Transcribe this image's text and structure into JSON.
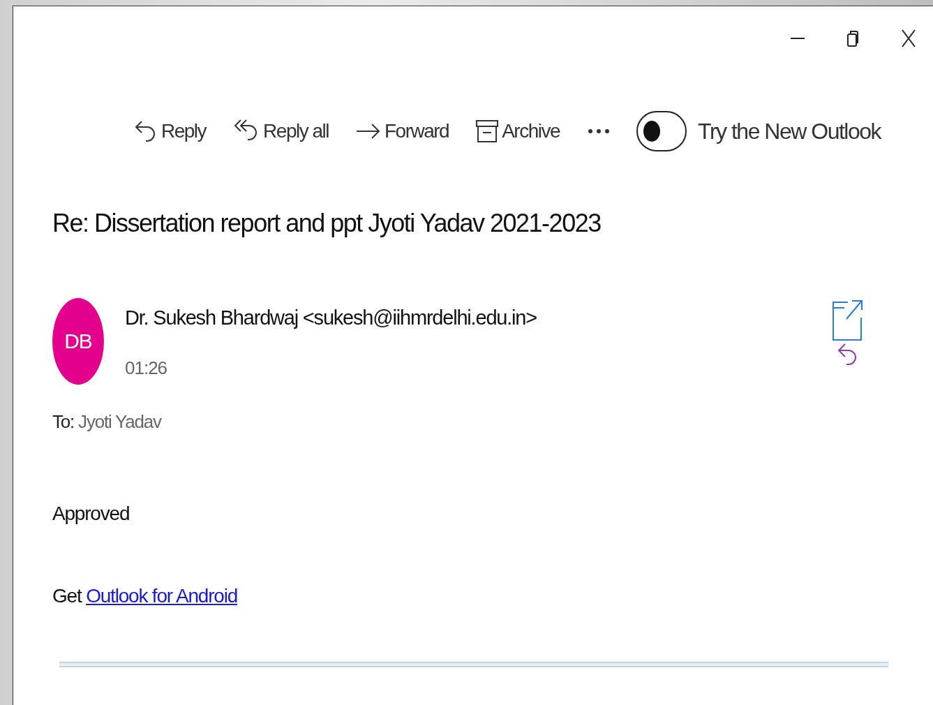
{
  "window_controls": [
    {
      "kind": "minimize"
    },
    {
      "kind": "restore"
    },
    {
      "kind": "close"
    }
  ],
  "toolbar": [
    {
      "kind": "reply",
      "label": "Reply"
    },
    {
      "kind": "reply_all",
      "label": "Reply all"
    },
    {
      "kind": "forward",
      "label": "Forward"
    },
    {
      "kind": "archive",
      "label": "Archive"
    },
    {
      "kind": "more"
    }
  ],
  "new_outlook_toggle": {
    "on": false,
    "label": "Try the New Outlook"
  },
  "subject": "Re: Dissertation report and ppt Jyoti Yadav 2021-2023",
  "sender": {
    "initials": "DB",
    "name": "Dr. Sukesh Bhardwaj <sukesh@iihmrdelhi.edu.in>",
    "time": "01:26"
  },
  "to": {
    "label": "To:",
    "value": "Jyoti Yadav"
  },
  "body": [
    {
      "kind": "text",
      "text": "Approved"
    },
    {
      "kind": "link_line",
      "prefix": "Get",
      "link": "Outlook for Android"
    }
  ]
}
